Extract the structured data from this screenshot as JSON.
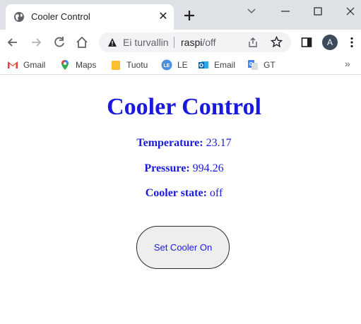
{
  "browser": {
    "tab": {
      "title": "Cooler Control",
      "close_glyph": "✕"
    },
    "new_tab_icon": "plus-icon",
    "address_bar": {
      "security_text": "Ei turvallin",
      "host": "raspi",
      "path": "/off"
    },
    "profile_initial": "A",
    "bookmarks": [
      {
        "label": "Gmail",
        "icon": "gmail-icon",
        "color": "#ea4335"
      },
      {
        "label": "Maps",
        "icon": "maps-icon",
        "color": "#34a853"
      },
      {
        "label": "Tuotu",
        "icon": "folder-icon",
        "color": "#fbc02d"
      },
      {
        "label": "LE",
        "icon": "le-icon",
        "color": "#4a90e2"
      },
      {
        "label": "Email",
        "icon": "outlook-icon",
        "color": "#0a64ad"
      },
      {
        "label": "GT",
        "icon": "translate-icon",
        "color": "#4285f4"
      }
    ],
    "bookmarks_more": "»"
  },
  "page": {
    "title": "Cooler Control",
    "temperature": {
      "label": "Temperature:",
      "value": "23.17"
    },
    "pressure": {
      "label": "Pressure:",
      "value": "994.26"
    },
    "cooler_state": {
      "label": "Cooler state:",
      "value": "off"
    },
    "button_label": "Set Cooler On",
    "accent_color": "#1a1adf"
  }
}
